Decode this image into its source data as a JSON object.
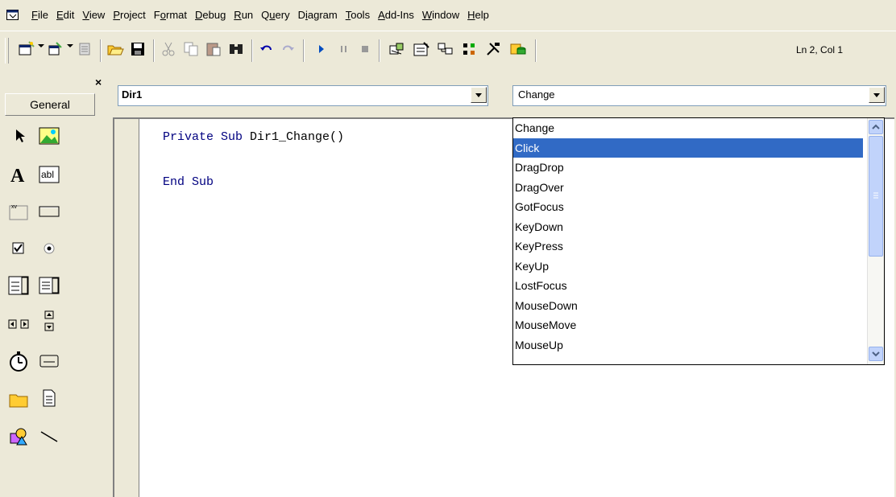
{
  "menubar": {
    "app_icon": "vb-project-icon",
    "items": [
      {
        "pre": "",
        "ul": "F",
        "post": "ile"
      },
      {
        "pre": "",
        "ul": "E",
        "post": "dit"
      },
      {
        "pre": "",
        "ul": "V",
        "post": "iew"
      },
      {
        "pre": "",
        "ul": "P",
        "post": "roject"
      },
      {
        "pre": "F",
        "ul": "o",
        "post": "rmat"
      },
      {
        "pre": "",
        "ul": "D",
        "post": "ebug"
      },
      {
        "pre": "",
        "ul": "R",
        "post": "un"
      },
      {
        "pre": "Q",
        "ul": "u",
        "post": "ery"
      },
      {
        "pre": "D",
        "ul": "i",
        "post": "agram"
      },
      {
        "pre": "",
        "ul": "T",
        "post": "ools"
      },
      {
        "pre": "",
        "ul": "A",
        "post": "dd-Ins"
      },
      {
        "pre": "",
        "ul": "W",
        "post": "indow"
      },
      {
        "pre": "",
        "ul": "H",
        "post": "elp"
      }
    ]
  },
  "toolbar": {
    "status": "Ln 2, Col 1",
    "icons": [
      "add-project-icon",
      "add-form-icon",
      "menu-editor-icon",
      "open-icon",
      "save-icon",
      "cut-icon",
      "copy-icon",
      "paste-icon",
      "find-icon",
      "undo-icon",
      "redo-icon",
      "run-icon",
      "pause-icon",
      "stop-icon",
      "project-explorer-icon",
      "properties-icon",
      "form-layout-icon",
      "object-browser-icon",
      "toolbox-icon",
      "data-view-icon"
    ]
  },
  "toolbox": {
    "tab_label": "General",
    "close": "×",
    "tools": [
      "pointer-icon",
      "picturebox-icon",
      "label-icon",
      "textbox-icon",
      "frame-icon",
      "commandbutton-icon",
      "checkbox-icon",
      "optionbutton-icon",
      "combobox-icon",
      "listbox-icon",
      "hscrollbar-icon",
      "vscrollbar-icon",
      "timer-icon",
      "drivelistbox-icon",
      "dirlistbox-icon",
      "filelistbox-icon",
      "shape-icon",
      "line-icon"
    ]
  },
  "code": {
    "object": "Dir1",
    "procedure": "Change",
    "lines": [
      {
        "kw": "Private Sub",
        "rest": " Dir1_Change()"
      },
      {
        "kw": "End Sub",
        "rest": ""
      }
    ]
  },
  "proc_list": {
    "selected": "Click",
    "options": [
      "Change",
      "Click",
      "DragDrop",
      "DragOver",
      "GotFocus",
      "KeyDown",
      "KeyPress",
      "KeyUp",
      "LostFocus",
      "MouseDown",
      "MouseMove",
      "MouseUp"
    ]
  },
  "colors": {
    "selection": "#316ac5",
    "keyword": "#000080",
    "chrome": "#ece9d8"
  }
}
